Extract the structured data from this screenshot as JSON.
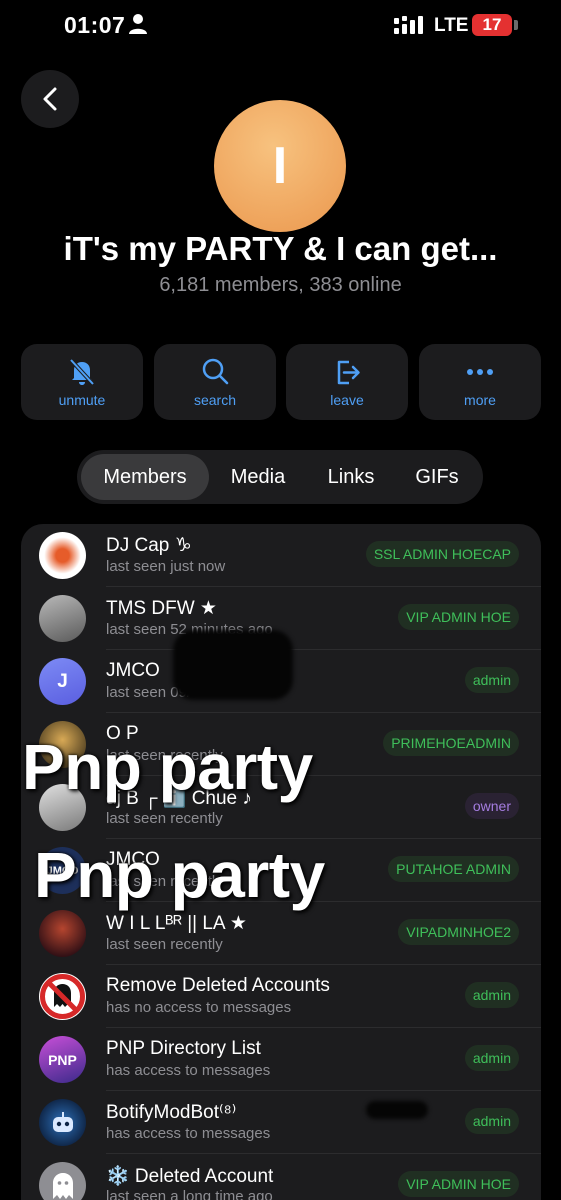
{
  "status_bar": {
    "time": "01:07",
    "network": "LTE",
    "battery": "17"
  },
  "group": {
    "avatar_letter": "I",
    "title": "iT's my PARTY & I can get...",
    "subtitle": "6,181 members, 383 online",
    "avatar_color": "#eea25a"
  },
  "actions": [
    {
      "label": "unmute",
      "icon": "bell-muted-icon"
    },
    {
      "label": "search",
      "icon": "search-icon"
    },
    {
      "label": "leave",
      "icon": "leave-icon"
    },
    {
      "label": "more",
      "icon": "more-icon"
    }
  ],
  "tabs": [
    {
      "label": "Members",
      "active": true
    },
    {
      "label": "Media"
    },
    {
      "label": "Links"
    },
    {
      "label": "GIFs"
    }
  ],
  "members": [
    {
      "name": "DJ Cap ♑",
      "status": "last seen just now",
      "role": "SSL ADMIN HOECAP"
    },
    {
      "name": "TMS DFW ★",
      "status": "last seen 52 minutes ago",
      "role": "VIP ADMIN HOE"
    },
    {
      "name": "JMCO",
      "status": "last seen 09/",
      "role": "admin",
      "initial": "J"
    },
    {
      "name": "O P",
      "status": "last seen recently",
      "role": "PRIMEHOEADMIN"
    },
    {
      "name": "dj B ┌ ℹ️ Chue ♪",
      "status": "last seen recently",
      "role": "owner"
    },
    {
      "name": "JMCO",
      "status": "last seen recently",
      "role": "PUTAHOE ADMIN",
      "avatar_text": "JMCO"
    },
    {
      "name": "W I L Lᴮᴿ || LA ★",
      "status": "last seen recently",
      "role": "VIPADMINHOE2"
    },
    {
      "name": "Remove Deleted Accounts",
      "status": "has no access to messages",
      "role": "admin"
    },
    {
      "name": "PNP Directory List",
      "status": "has access to messages",
      "role": "admin",
      "avatar_text": "PNP"
    },
    {
      "name": "BotifyModBot⁽⁸⁾",
      "status": "has access to messages",
      "role": "admin"
    },
    {
      "name": "❄️ Deleted Account",
      "status": "last seen a long time ago",
      "role": "VIP ADMIN HOE"
    }
  ],
  "overlay": {
    "line1": "Pnp party",
    "line2": "Pnp party"
  },
  "colors": {
    "accent": "#4f9ff5",
    "admin_green": "#3fbf5a",
    "owner_purple": "#a57de0",
    "battery_red": "#e43131"
  }
}
